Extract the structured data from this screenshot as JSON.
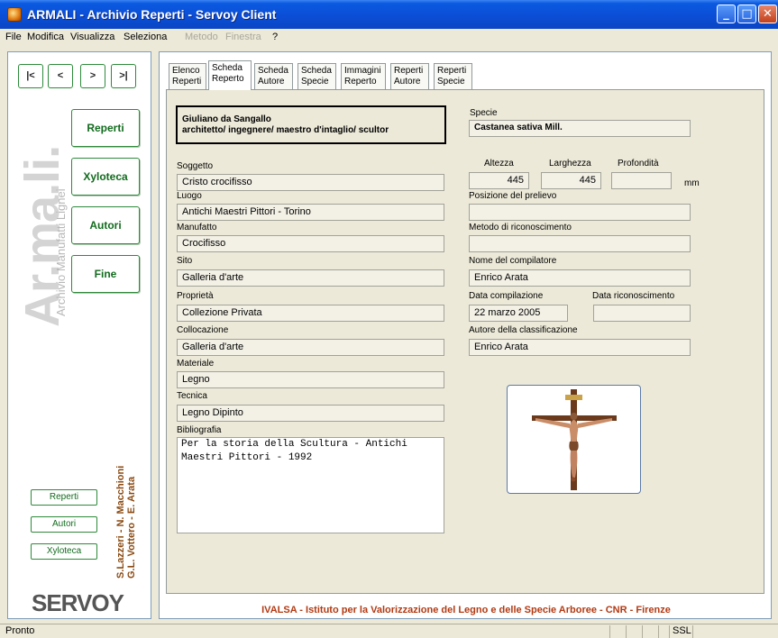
{
  "window": {
    "title": "ARMALI - Archivio Reperti - Servoy Client"
  },
  "menu": [
    "File",
    "Modifica",
    "Visualizza",
    "Seleziona",
    "Metodo",
    "Finestra",
    "?"
  ],
  "nav": {
    "first": "|<",
    "prev": "<",
    "next": ">",
    "last": ">|"
  },
  "sidebar": {
    "buttons": [
      "Reperti",
      "Xyloteca",
      "Autori",
      "Fine"
    ],
    "brand_big": "Ar.ma.li.",
    "brand_small": "Archivio Manufatti Lignei",
    "small_buttons": [
      "Reperti",
      "Autori",
      "Xyloteca"
    ],
    "credits_line1": "S.Lazzeri - N. Macchioni",
    "credits_line2": "G.L. Vottero - E. Arata",
    "logo_pre": "SERV",
    "logo_o": "O",
    "logo_post": "Y"
  },
  "tabs": [
    {
      "line1": "Elenco",
      "line2": "Reperti"
    },
    {
      "line1": "Scheda",
      "line2": "Reperto"
    },
    {
      "line1": "Scheda",
      "line2": "Autore"
    },
    {
      "line1": "Scheda",
      "line2": "Specie"
    },
    {
      "line1": "Immagini",
      "line2": "Reperto"
    },
    {
      "line1": "Reperti",
      "line2": "Autore"
    },
    {
      "line1": "Reperti",
      "line2": "Specie"
    }
  ],
  "active_tab": "Scheda Reperto",
  "record": {
    "author_line1": "Giuliano da Sangallo",
    "author_line2": "architetto/ ingegnere/ maestro d'intaglio/ scultor",
    "specie_label": "Specie",
    "specie": "Castanea sativa Mill.",
    "soggetto_label": "Soggetto",
    "soggetto": "Cristo crocifisso",
    "luogo_label": "Luogo",
    "luogo": "Antichi Maestri Pittori - Torino",
    "manufatto_label": "Manufatto",
    "manufatto": "Crocifisso",
    "sito_label": "Sito",
    "sito": "Galleria d'arte",
    "proprieta_label": "Proprietà",
    "proprieta": "Collezione Privata",
    "collocazione_label": "Collocazione",
    "collocazione": "Galleria d'arte",
    "materiale_label": "Materiale",
    "materiale": "Legno",
    "tecnica_label": "Tecnica",
    "tecnica": "Legno Dipinto",
    "bibliografia_label": "Bibliografia",
    "bibliografia": "Per la storia della Scultura - Antichi Maestri Pittori - 1992",
    "altezza_label": "Altezza",
    "altezza": "445",
    "larghezza_label": "Larghezza",
    "larghezza": "445",
    "profondita_label": "Profondità",
    "profondita": "",
    "unit": "mm",
    "posizione_label": "Posizione del prelievo",
    "posizione": "",
    "metodo_label": "Metodo di riconoscimento",
    "metodo": "",
    "compilatore_label": "Nome del compilatore",
    "compilatore": "Enrico Arata",
    "data_compilazione_label": "Data compilazione",
    "data_compilazione": "22 marzo 2005",
    "data_riconoscimento_label": "Data riconoscimento",
    "data_riconoscimento": "",
    "autore_classificazione_label": "Autore della classificazione",
    "autore_classificazione": "Enrico Arata"
  },
  "footer": "IVALSA - Istituto per la Valorizzazione del Legno e delle Specie Arboree - CNR - Firenze",
  "status": {
    "text": "Pronto",
    "ssl": "SSL"
  }
}
